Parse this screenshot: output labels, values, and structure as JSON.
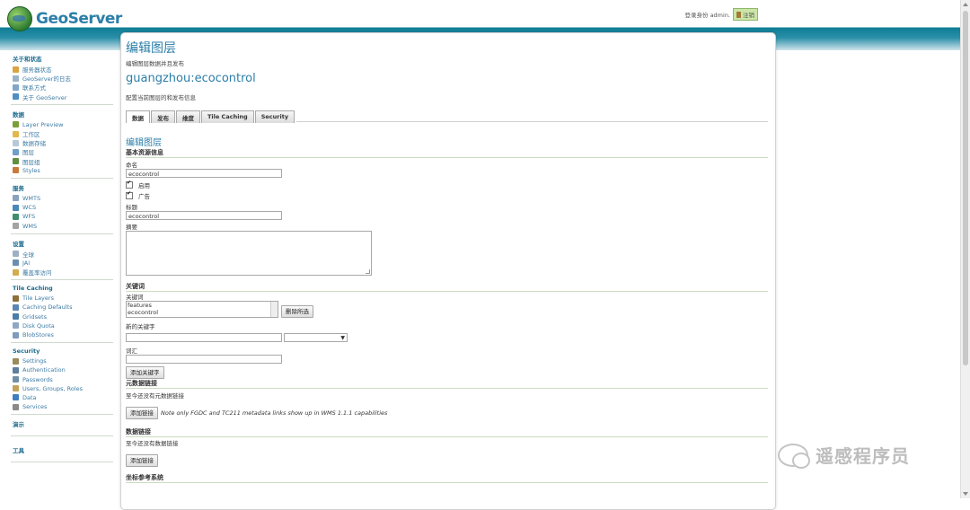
{
  "header": {
    "brand": "GeoServer",
    "login_text": "登录身份 admin.",
    "logout_label": "注销"
  },
  "sidebar": {
    "sections": [
      {
        "title": "关于和状态",
        "items": [
          "服务器状态",
          "GeoServer的日志",
          "联系方式",
          "关于 GeoServer"
        ]
      },
      {
        "title": "数据",
        "items": [
          "Layer Preview",
          "工作区",
          "数据存储",
          "图层",
          "图层组",
          "Styles"
        ]
      },
      {
        "title": "服务",
        "items": [
          "WMTS",
          "WCS",
          "WFS",
          "WMS"
        ]
      },
      {
        "title": "设置",
        "items": [
          "全球",
          "JAI",
          "覆盖率访问"
        ]
      },
      {
        "title": "Tile Caching",
        "items": [
          "Tile Layers",
          "Caching Defaults",
          "Gridsets",
          "Disk Quota",
          "BlobStores"
        ]
      },
      {
        "title": "Security",
        "items": [
          "Settings",
          "Authentication",
          "Passwords",
          "Users, Groups, Roles",
          "Data",
          "Services"
        ]
      },
      {
        "title": "演示",
        "items": []
      },
      {
        "title": "工具",
        "items": []
      }
    ]
  },
  "main": {
    "title": "编辑图层",
    "description": "编辑图层数据并且发布",
    "layer_name": "guangzhou:ecocontrol",
    "layer_description": "配置当前图层的和发布信息",
    "tabs": [
      "数据",
      "发布",
      "维度",
      "Tile Caching",
      "Security"
    ],
    "active_tab": "数据"
  },
  "form": {
    "section_title": "编辑图层",
    "basic_title": "基本资源信息",
    "name_label": "命名",
    "name_value": "ecocontrol",
    "enabled_label": "启用",
    "advertised_label": "广告",
    "title_label": "标题",
    "title_value": "ecocontrol",
    "abstract_label": "摘要",
    "keywords_title": "关键词",
    "keywords_label": "关键词",
    "keywords": [
      "features",
      "ecocontrol"
    ],
    "remove_selected": "删除所选",
    "new_keyword_label": "新的关键字",
    "vocabulary_label": "词汇",
    "add_keyword": "添加关键字",
    "metadata_title": "元数据链接",
    "metadata_empty": "至今还没有元数据链接",
    "add_link": "添加链接",
    "metadata_note": "Note only FGDC and TC211 metadata links show up in WMS 1.1.1 capabilities",
    "datalinks_title": "数据链接",
    "datalinks_empty": "至今还没有数据链接",
    "add_datalink": "添加链接",
    "crs_title": "坐标参考系统"
  },
  "watermark": "遥感程序员"
}
